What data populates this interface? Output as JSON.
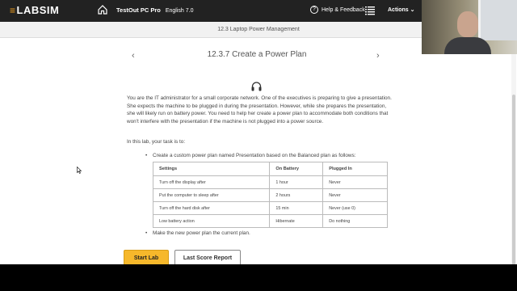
{
  "app": {
    "logo_text": "LABSIM",
    "course_title": "TestOut PC Pro",
    "course_lang": "English 7.0",
    "help_label": "Help & Feedback",
    "actions_label": "Actions"
  },
  "breadcrumb": "12.3 Laptop Power Management",
  "lab": {
    "title": "12.3.7 Create a Power Plan",
    "description": "You are the IT administrator for a small corporate network. One of the executives is preparing to give a presentation. She expects the machine to be plugged in during the presentation. However, while she prepares the presentation, she will likely run on battery power. You need to help her create a power plan to accommodate both conditions that won't interfere with the presentation if the machine is not plugged into a power source.",
    "task_intro": "In this lab, your task is to:",
    "tasks": [
      "Create a custom power plan named Presentation based on the Balanced plan as follows:",
      "Make the new power plan the current plan."
    ],
    "table": {
      "headers": [
        "Settings",
        "On Battery",
        "Plugged In"
      ],
      "rows": [
        [
          "Turn off the display after",
          "1 hour",
          "Never"
        ],
        [
          "Put the computer to sleep after",
          "2 hours",
          "Never"
        ],
        [
          "Turn off the hard disk after",
          "15 min",
          "Never (use 0)"
        ],
        [
          "Low battery action",
          "Hibernate",
          "Do nothing"
        ]
      ]
    },
    "start_button": "Start Lab",
    "score_button": "Last Score Report"
  },
  "colors": {
    "topbar": "#222222",
    "accent": "#f6b82b",
    "logo_mark": "#f2a01d"
  },
  "icons": {
    "home": "home-icon",
    "help": "help-circle-icon",
    "list": "list-icon",
    "headset": "headset-icon",
    "prev": "chevron-left-icon",
    "next": "chevron-right-icon"
  }
}
